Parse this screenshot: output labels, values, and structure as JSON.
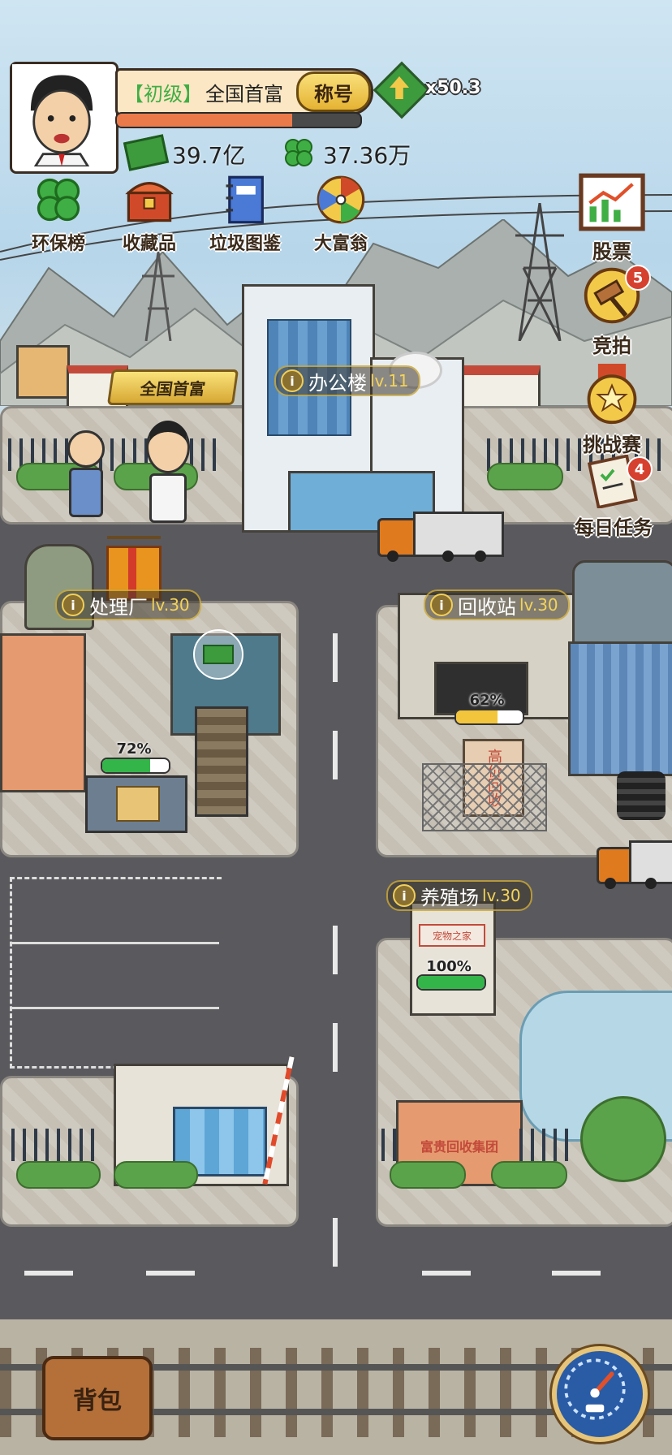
{
  "player": {
    "rank_tag": "【初级】",
    "rank_title": "全国首富",
    "title_button": "称号",
    "multiplier": "x50.3",
    "money": "39.7亿",
    "clover": "37.36万",
    "level_progress": 0.72
  },
  "top_menu": [
    {
      "icon": "clover-icon",
      "label": "环保榜"
    },
    {
      "icon": "treasure-chest-icon",
      "label": "收藏品"
    },
    {
      "icon": "notebook-icon",
      "label": "垃圾图鉴"
    },
    {
      "icon": "roulette-wheel-icon",
      "label": "大富翁"
    }
  ],
  "right_menu": [
    {
      "icon": "stock-chart-icon",
      "label": "股票",
      "badge": ""
    },
    {
      "icon": "auction-gavel-icon",
      "label": "竞拍",
      "badge": "5"
    },
    {
      "icon": "medal-icon",
      "label": "挑战赛",
      "badge": ""
    },
    {
      "icon": "task-clipboard-icon",
      "label": "每日任务",
      "badge": "4"
    }
  ],
  "buildings": {
    "office": {
      "name": "办公楼",
      "level": "lv.11"
    },
    "processing": {
      "name": "处理厂",
      "level": "lv.30",
      "progress_text": "72%",
      "progress": 0.72
    },
    "recycling": {
      "name": "回收站",
      "level": "lv.30",
      "progress_text": "62%",
      "progress": 0.62,
      "sign": "高价回收"
    },
    "farm": {
      "name": "养殖场",
      "level": "lv.30",
      "progress_text": "100%",
      "progress": 1.0,
      "sign": "宠物之家"
    },
    "hq_sign": "富贵回收集团"
  },
  "hero_banner": "全国首富",
  "backpack_label": "背包",
  "colors": {
    "gold": "#f3c94a",
    "panel_bg": "#fbe7c4",
    "progress_green": "#34b54a",
    "badge_red": "#d6402e",
    "road": "#5a5a5e"
  }
}
